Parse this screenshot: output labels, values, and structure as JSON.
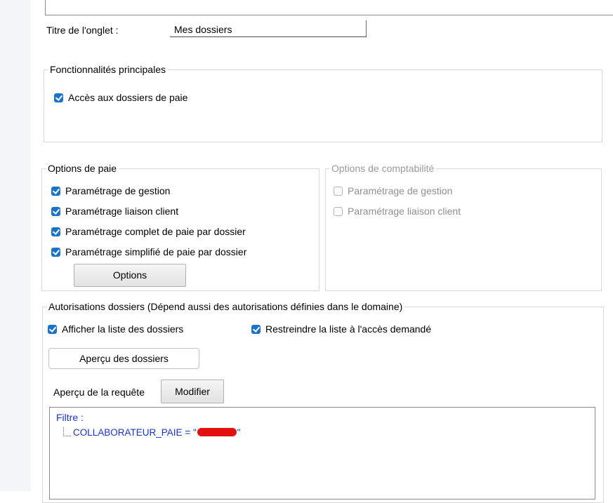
{
  "tab_title": {
    "label": "Titre de l'onglet :",
    "value": "Mes dossiers"
  },
  "main_features": {
    "legend": "Fonctionnalités principales",
    "payroll_access": {
      "label": "Accès aux dossiers de paie",
      "checked": true
    }
  },
  "payroll_options": {
    "legend": "Options de paie",
    "items": [
      {
        "label": "Paramétrage de gestion",
        "checked": true
      },
      {
        "label": "Paramétrage liaison client",
        "checked": true
      },
      {
        "label": "Paramétrage complet de paie par dossier",
        "checked": true
      },
      {
        "label": "Paramétrage simplifié de paie par dossier",
        "checked": true
      }
    ],
    "options_button": "Options"
  },
  "accounting_options": {
    "legend": "Options de comptabilité",
    "items": [
      {
        "label": "Paramétrage de gestion",
        "checked": false
      },
      {
        "label": "Paramétrage liaison client",
        "checked": false
      }
    ]
  },
  "folder_auth": {
    "legend": "Autorisations dossiers (Dépend aussi des autorisations définies dans le domaine)",
    "show_list": {
      "label": "Afficher la liste des dossiers",
      "checked": true
    },
    "restrict_list": {
      "label": "Restreindre la liste à l'accès demandé",
      "checked": true
    },
    "preview_button": "Aperçu des dossiers",
    "query_label": "Aperçu de la requête",
    "modify_button": "Modifier",
    "filter": {
      "title": "Filtre :",
      "field": "COLLABORATEUR_PAIE",
      "operator": "=",
      "value_prefix": "\"",
      "value_suffix": "\""
    }
  },
  "colors": {
    "accent": "#1a73c9",
    "query_text": "#1633cc",
    "redaction": "#e31010"
  }
}
